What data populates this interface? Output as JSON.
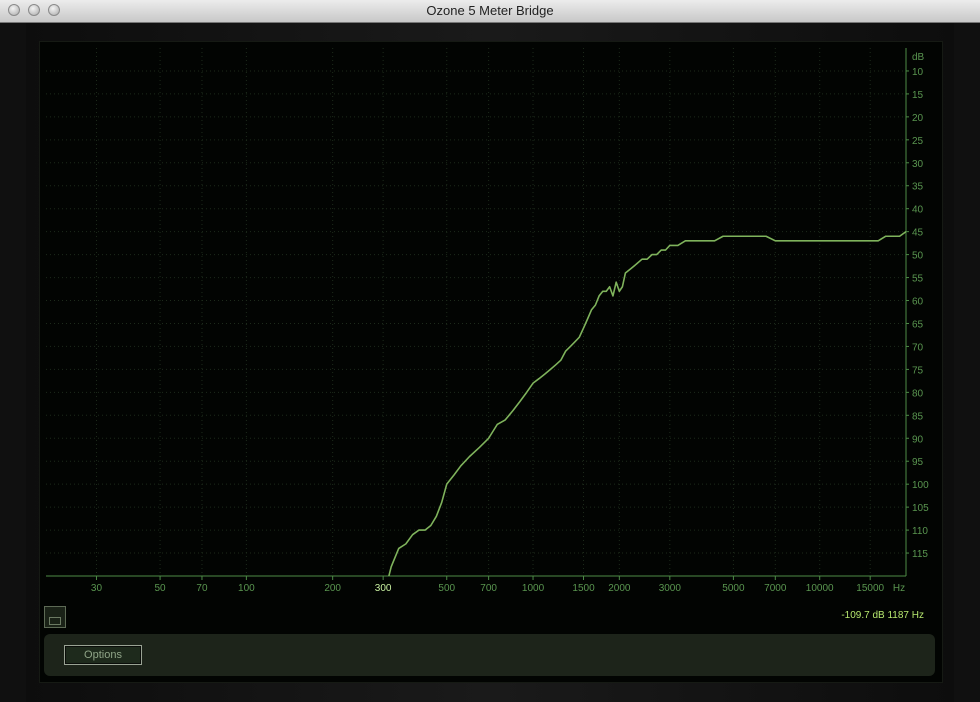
{
  "window": {
    "title": "Ozone 5 Meter Bridge"
  },
  "readout": {
    "text": "-109.7 dB 1187 Hz"
  },
  "options_label": "Options",
  "colors": {
    "trace": "#7fb35c",
    "axis": "#4e8c47",
    "label": "#5a9650",
    "highlight": "#b7e86f"
  },
  "chart_data": {
    "type": "line",
    "title": "",
    "xlabel": "Hz",
    "ylabel": "dB",
    "x_scale": "log",
    "x_ticks": [
      30,
      50,
      70,
      100,
      200,
      300,
      500,
      700,
      1000,
      1500,
      2000,
      3000,
      5000,
      7000,
      10000,
      15000
    ],
    "x_tick_labels": [
      "30",
      "50",
      "70",
      "100",
      "200",
      "300",
      "500",
      "700",
      "1000",
      "1500",
      "2000",
      "3000",
      "5000",
      "7000",
      "10000",
      "15000"
    ],
    "x_highlight_tick": "300",
    "y_ticks": [
      -10,
      -15,
      -20,
      -25,
      -30,
      -35,
      -40,
      -45,
      -50,
      -55,
      -60,
      -65,
      -70,
      -75,
      -80,
      -85,
      -90,
      -95,
      -100,
      -105,
      -110,
      -115
    ],
    "y_tick_labels": [
      "10",
      "15",
      "20",
      "25",
      "30",
      "35",
      "40",
      "45",
      "50",
      "55",
      "60",
      "65",
      "70",
      "75",
      "80",
      "85",
      "90",
      "95",
      "100",
      "105",
      "110",
      "115"
    ],
    "ylim": [
      -120,
      -5
    ],
    "xlim": [
      20,
      20000
    ],
    "grid": true,
    "series": [
      {
        "x": [
          300,
          320,
          340,
          360,
          380,
          400,
          420,
          440,
          460,
          480,
          500,
          530,
          560,
          600,
          650,
          700,
          750,
          800,
          850,
          900,
          950,
          1000,
          1050,
          1100,
          1150,
          1200,
          1250,
          1300,
          1350,
          1400,
          1450,
          1500,
          1550,
          1600,
          1650,
          1700,
          1750,
          1800,
          1850,
          1900,
          1950,
          2000,
          2050,
          2100,
          2200,
          2300,
          2400,
          2500,
          2600,
          2700,
          2800,
          2900,
          3000,
          3200,
          3400,
          3600,
          3800,
          4000,
          4300,
          4600,
          5000,
          5500,
          6000,
          6500,
          7000,
          8000,
          9000,
          10000,
          11000,
          12000,
          13000,
          14000,
          15000,
          16000,
          17000,
          18000,
          19000,
          20000
        ],
        "y": [
          -125,
          -118,
          -114,
          -113,
          -111,
          -110,
          -110,
          -109,
          -107,
          -104,
          -100,
          -98,
          -96,
          -94,
          -92,
          -90,
          -87,
          -86,
          -84,
          -82,
          -80,
          -78,
          -77,
          -76,
          -75,
          -74,
          -73,
          -71,
          -70,
          -69,
          -68,
          -66,
          -64,
          -62,
          -61,
          -59,
          -58,
          -58,
          -57,
          -59,
          -56,
          -58,
          -57,
          -54,
          -53,
          -52,
          -51,
          -51,
          -50,
          -50,
          -49,
          -49,
          -48,
          -48,
          -47,
          -47,
          -47,
          -47,
          -47,
          -46,
          -46,
          -46,
          -46,
          -46,
          -47,
          -47,
          -47,
          -47,
          -47,
          -47,
          -47,
          -47,
          -47,
          -47,
          -46,
          -46,
          -46,
          -45
        ]
      }
    ]
  }
}
